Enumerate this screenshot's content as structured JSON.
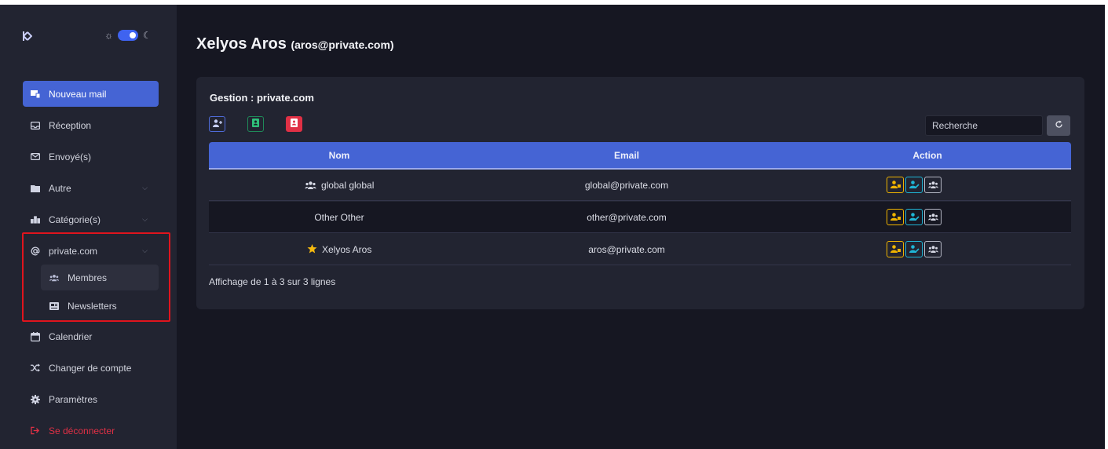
{
  "theme": {
    "mode": "dark",
    "sun_icon": "☼",
    "moon_icon": "☾"
  },
  "sidebar": {
    "new_mail": "Nouveau mail",
    "items": [
      {
        "label": "Réception",
        "icon": "inbox-icon"
      },
      {
        "label": "Envoyé(s)",
        "icon": "envelope-icon"
      },
      {
        "label": "Autre",
        "icon": "folder-icon",
        "chevron": "⌵"
      },
      {
        "label": "Catégorie(s)",
        "icon": "categories-icon",
        "chevron": "⌵"
      },
      {
        "label": "private.com",
        "icon": "at-icon",
        "chevron": "⌵"
      }
    ],
    "sub_items": [
      {
        "label": "Membres",
        "icon": "users-icon"
      },
      {
        "label": "Newsletters",
        "icon": "newspaper-icon"
      }
    ],
    "bottom_items": [
      {
        "label": "Calendrier",
        "icon": "calendar-icon"
      },
      {
        "label": "Changer de compte",
        "icon": "shuffle-icon"
      },
      {
        "label": "Paramètres",
        "icon": "gear-icon"
      },
      {
        "label": "Se déconnecter",
        "icon": "logout-icon"
      }
    ]
  },
  "header": {
    "name": "Xelyos Aros",
    "email": "(aros@private.com)"
  },
  "card": {
    "title": "Gestion : private.com",
    "search_label": "Recherche",
    "columns": [
      "Nom",
      "Email",
      "Action"
    ],
    "rows": [
      {
        "name": "global global",
        "email": "global@private.com",
        "prefix_icon": "users-icon"
      },
      {
        "name": "Other Other",
        "email": "other@private.com",
        "prefix_icon": ""
      },
      {
        "name": "Xelyos Aros",
        "email": "aros@private.com",
        "prefix_icon": "star-icon"
      }
    ],
    "pagination_info": "Affichage de 1 à 3 sur 3 lignes"
  },
  "colors": {
    "primary": "#4564d4",
    "danger": "#e03045",
    "success": "#1f8a59",
    "warning": "#f0b400",
    "info": "#1fb6d6",
    "bg": "#161722",
    "panel": "#222431"
  }
}
